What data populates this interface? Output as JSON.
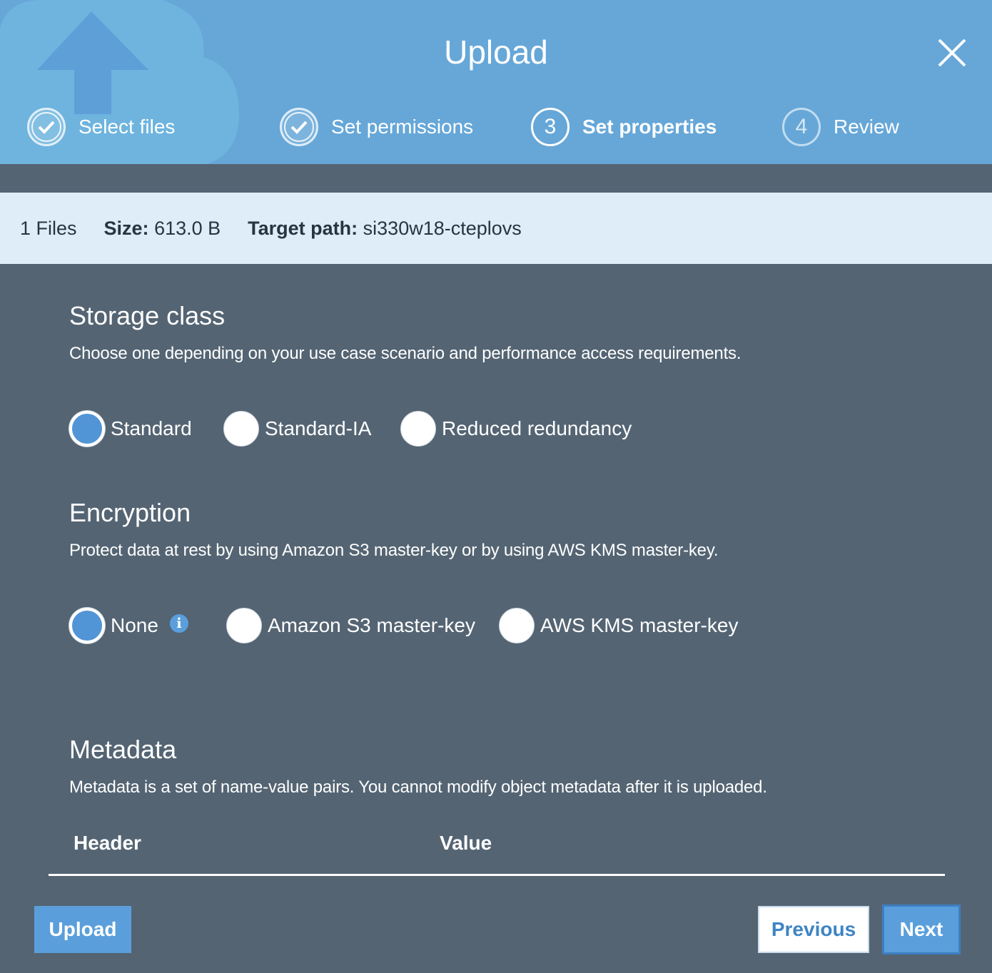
{
  "header": {
    "title": "Upload",
    "steps": [
      {
        "number": "1",
        "label": "Select files",
        "state": "done"
      },
      {
        "number": "2",
        "label": "Set permissions",
        "state": "done"
      },
      {
        "number": "3",
        "label": "Set properties",
        "state": "active"
      },
      {
        "number": "4",
        "label": "Review",
        "state": "pending"
      }
    ]
  },
  "summary": {
    "files": "1 Files",
    "size_label": "Size:",
    "size_value": "613.0 B",
    "target_label": "Target path:",
    "target_value": "si330w18-cteplovs"
  },
  "storage_class": {
    "title": "Storage class",
    "description": "Choose one depending on your use case scenario and performance access requirements.",
    "options": [
      "Standard",
      "Standard-IA",
      "Reduced redundancy"
    ],
    "selected": "Standard"
  },
  "encryption": {
    "title": "Encryption",
    "description": "Protect data at rest by using Amazon S3 master-key or by using AWS KMS master-key.",
    "options": [
      "None",
      "Amazon S3 master-key",
      "AWS KMS master-key"
    ],
    "selected": "None",
    "info_glyph": "i"
  },
  "metadata": {
    "title": "Metadata",
    "description": "Metadata is a set of name-value pairs. You cannot modify object metadata after it is uploaded.",
    "columns": [
      "Header",
      "Value"
    ]
  },
  "footer": {
    "upload_label": "Upload",
    "previous_label": "Previous",
    "next_label": "Next"
  },
  "colors": {
    "header_bg": "#66a7d8",
    "body_bg": "#546473",
    "summary_bg": "#deedf8",
    "accent": "#5a9fdb"
  }
}
